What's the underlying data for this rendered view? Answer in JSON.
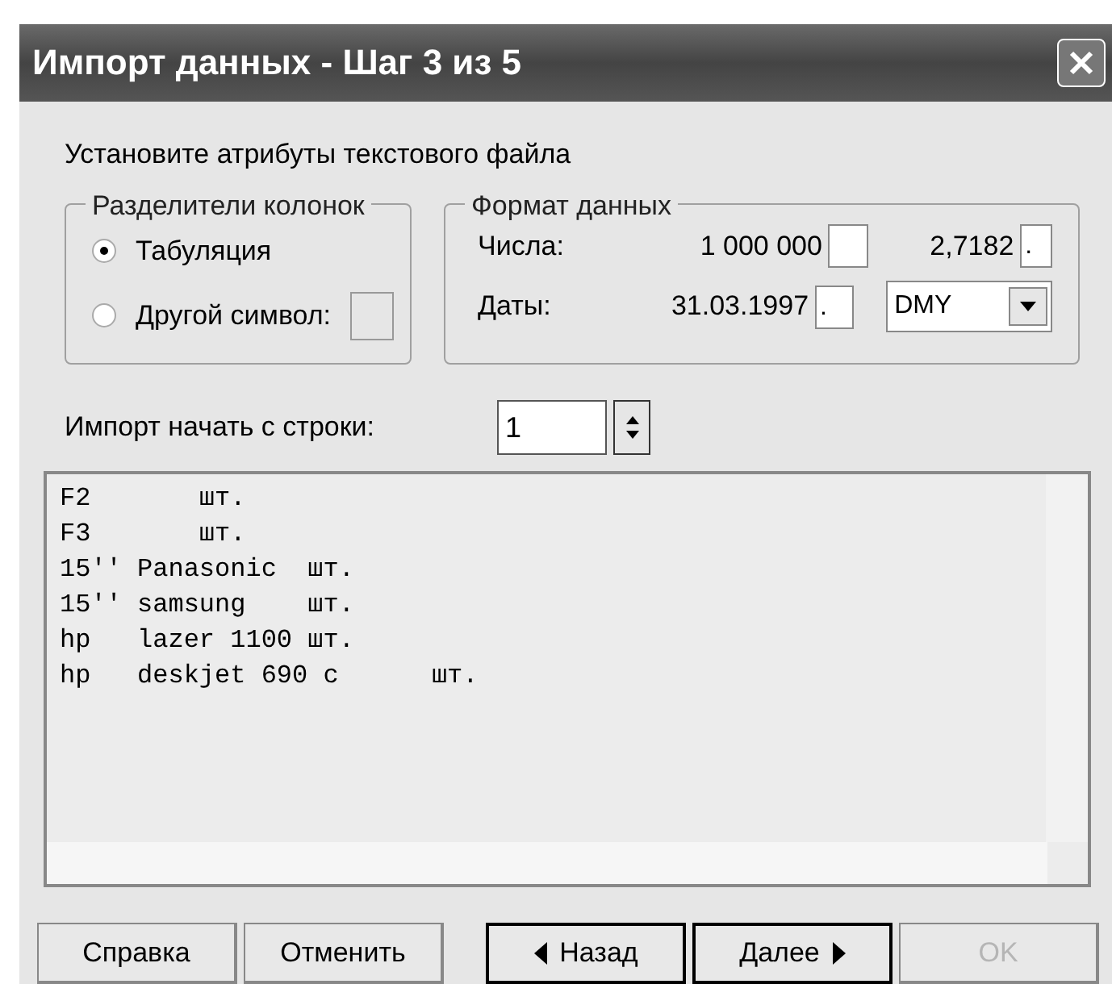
{
  "window": {
    "title": "Импорт данных - Шаг 3 из 5"
  },
  "instruction": "Установите атрибуты текстового файла",
  "separators": {
    "title": "Разделители колонок",
    "options": [
      {
        "label": "Табуляция",
        "selected": true,
        "kind": "plain"
      },
      {
        "label": "Другой символ:",
        "selected": false,
        "kind": "with-field"
      }
    ]
  },
  "data_format": {
    "title": "Формат данных",
    "numbers": {
      "label": "Числа:",
      "sample_1": "1 000 000",
      "sample_2": "2,7182",
      "decimal_separator": "."
    },
    "dates": {
      "label": "Даты:",
      "sample": "31.03.1997",
      "separator": ".",
      "order": "DMY"
    }
  },
  "start_row": {
    "label": "Импорт начать с строки:",
    "value": "1"
  },
  "preview_lines": [
    "F2       шт.",
    "F3       шт.",
    "15'' Panasonic  шт.",
    "15'' samsung    шт.",
    "hp   lazer 1100 шт.",
    "hp   deskjet 690 c      шт."
  ],
  "buttons": [
    {
      "label": "Справка",
      "kind": "plain",
      "disabled": false
    },
    {
      "label": "Отменить",
      "kind": "plain",
      "disabled": false
    },
    {
      "label": "Назад",
      "kind": "back",
      "disabled": false
    },
    {
      "label": "Далее",
      "kind": "next",
      "disabled": false
    },
    {
      "label": "OK",
      "kind": "plain",
      "disabled": true
    }
  ]
}
